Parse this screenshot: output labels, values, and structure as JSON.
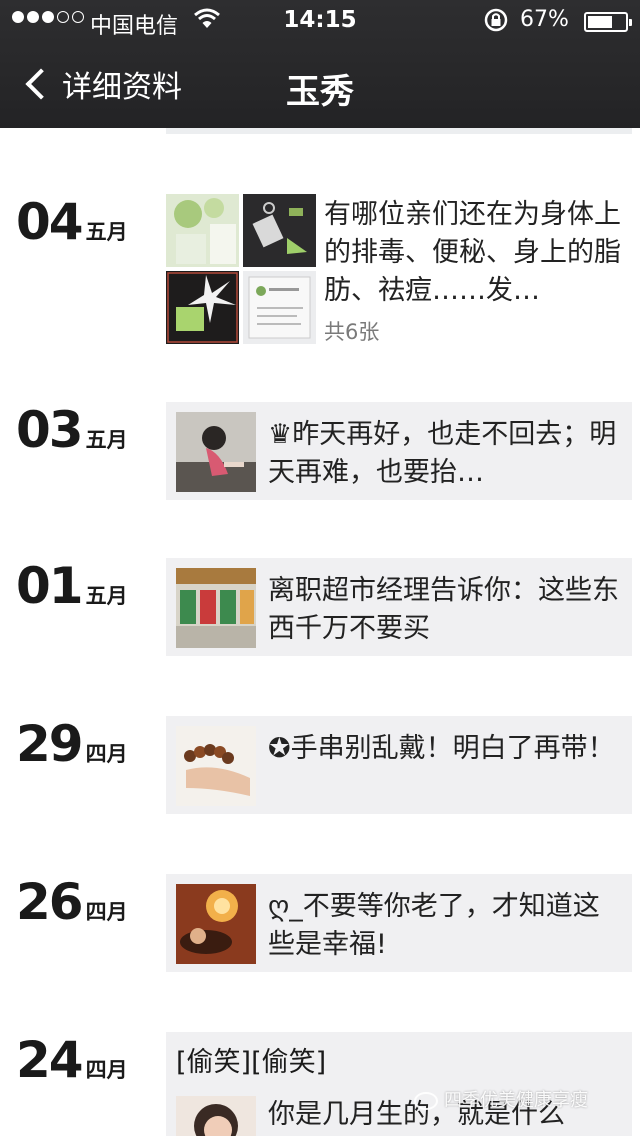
{
  "status_bar": {
    "carrier": "中国电信",
    "time": "14:15",
    "battery_percent": "67%",
    "battery_level": 0.67,
    "signal_bars_filled": 3,
    "signal_bars_total": 5
  },
  "nav": {
    "back_label": "详细资料",
    "title": "玉秀"
  },
  "posts": [
    {
      "day": "04",
      "month": "五月",
      "text": "有哪位亲们还在为身体上的排毒、便秘、身上的脂肪、祛痘……发…",
      "count": "共6张"
    },
    {
      "day": "03",
      "month": "五月",
      "text": "♛昨天再好，也走不回去；明天再难，也要抬…"
    },
    {
      "day": "01",
      "month": "五月",
      "text": "离职超市经理告诉你：这些东西千万不要买"
    },
    {
      "day": "29",
      "month": "四月",
      "text": "✪手串别乱戴！明白了再带！"
    },
    {
      "day": "26",
      "month": "四月",
      "text": "ღ_不要等你老了，才知道这些是幸福!"
    },
    {
      "day": "24",
      "month": "四月",
      "header": "[偷笑][偷笑]",
      "text": "你是几月生的，就是什么"
    }
  ],
  "watermark": "四季优美健康享瘦",
  "colors": {
    "navbar": "#2a2a2c",
    "card": "#f0f0f2",
    "background": "#ffffff"
  }
}
